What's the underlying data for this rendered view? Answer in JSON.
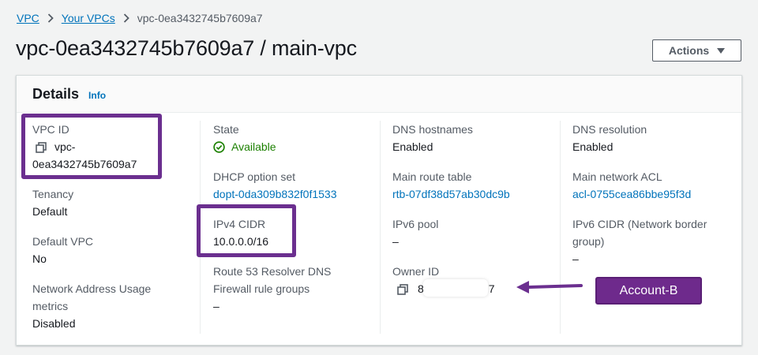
{
  "breadcrumb": {
    "items": [
      "VPC",
      "Your VPCs"
    ],
    "current": "vpc-0ea3432745b7609a7"
  },
  "page": {
    "title": "vpc-0ea3432745b7609a7 / main-vpc",
    "actions_label": "Actions"
  },
  "details": {
    "title": "Details",
    "info": "Info",
    "vpc_id": {
      "label": "VPC ID",
      "value_line1": "vpc-",
      "value_line2": "0ea3432745b7609a7"
    },
    "tenancy": {
      "label": "Tenancy",
      "value": "Default"
    },
    "default_vpc": {
      "label": "Default VPC",
      "value": "No"
    },
    "nau_metrics": {
      "label_line1": "Network Address Usage",
      "label_line2": "metrics",
      "value": "Disabled"
    },
    "state": {
      "label": "State",
      "value": "Available"
    },
    "dhcp": {
      "label": "DHCP option set",
      "value": "dopt-0da309b832f0f1533"
    },
    "ipv4_cidr": {
      "label": "IPv4 CIDR",
      "value": "10.0.0.0/16"
    },
    "r53": {
      "label_line1": "Route 53 Resolver DNS",
      "label_line2": "Firewall rule groups",
      "value": "–"
    },
    "dns_hostnames": {
      "label": "DNS hostnames",
      "value": "Enabled"
    },
    "main_route_table": {
      "label": "Main route table",
      "value": "rtb-07df38d57ab30dc9b"
    },
    "ipv6_pool": {
      "label": "IPv6 pool",
      "value": "–"
    },
    "owner_id": {
      "label": "Owner ID",
      "value_start": "8",
      "value_end": "7"
    },
    "dns_resolution": {
      "label": "DNS resolution",
      "value": "Enabled"
    },
    "main_acl": {
      "label": "Main network ACL",
      "value": "acl-0755cea86bbe95f3d"
    },
    "ipv6_cidr": {
      "label_line1": "IPv6 CIDR (Network border",
      "label_line2": "group)",
      "value": "–"
    }
  },
  "annotation": {
    "badge_text": "Account-B",
    "highlight_color": "#6b2f8f"
  },
  "colors": {
    "link": "#0073bb",
    "success": "#1d8102",
    "text": "#16191f",
    "label": "#545b64"
  }
}
